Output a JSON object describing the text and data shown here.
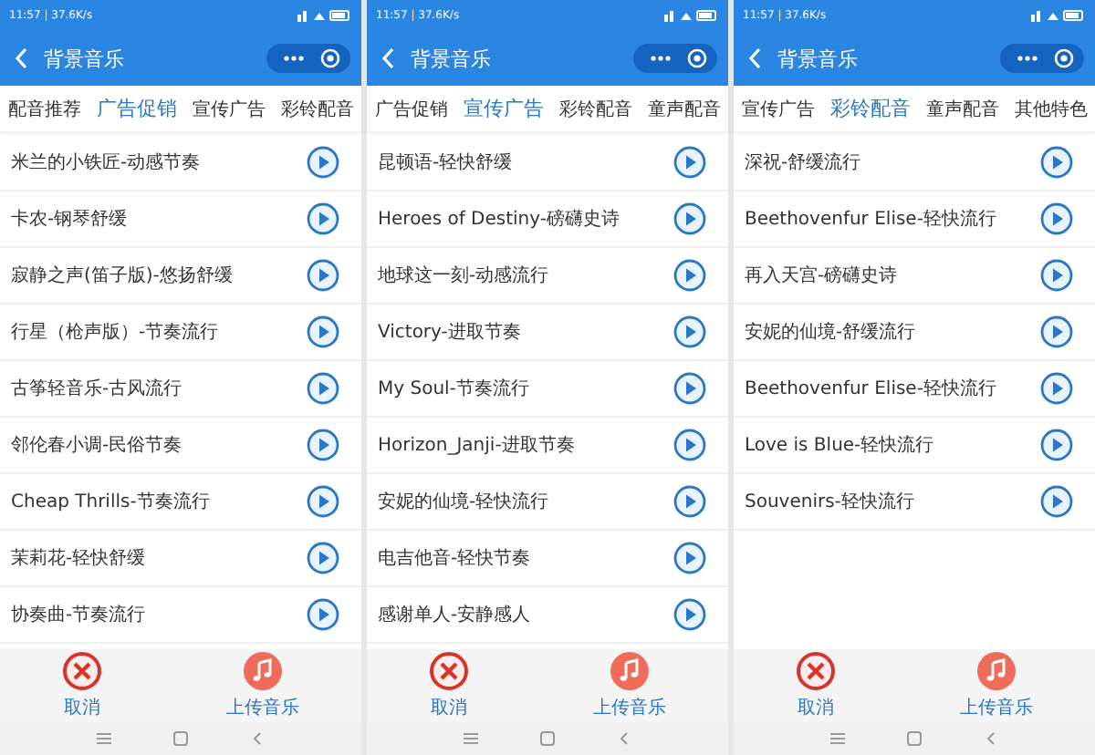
{
  "phones": [
    {
      "status": "11:57 | 37.6K/s",
      "title": "背景音乐",
      "tabs": [
        {
          "label": "配音推荐",
          "selected": false
        },
        {
          "label": "广告促销",
          "selected": true
        },
        {
          "label": "宣传广告",
          "selected": false
        },
        {
          "label": "彩铃配音",
          "selected": false
        }
      ],
      "songs": [
        "米兰的小铁匠-动感节奏",
        "卡农-钢琴舒缓",
        "寂静之声(笛子版)-悠扬舒缓",
        "行星（枪声版）-节奏流行",
        "古筝轻音乐-古风流行",
        "邻伦春小调-民俗节奏",
        "Cheap Thrills-节奏流行",
        "茉莉花-轻快舒缓",
        "协奏曲-节奏流行"
      ],
      "buttons": [
        {
          "kind": "cancel",
          "label": "取消"
        },
        {
          "kind": "upload",
          "label": "上传音乐"
        }
      ]
    },
    {
      "status": "11:57 | 37.6K/s",
      "title": "背景音乐",
      "tabs": [
        {
          "label": "广告促销",
          "selected": false
        },
        {
          "label": "宣传广告",
          "selected": true
        },
        {
          "label": "彩铃配音",
          "selected": false
        },
        {
          "label": "童声配音",
          "selected": false
        }
      ],
      "songs": [
        "昆顿语-轻快舒缓",
        "Heroes of Destiny-磅礴史诗",
        "地球这一刻-动感流行",
        "Victory-进取节奏",
        "My Soul-节奏流行",
        "Horizon_Janji-进取节奏",
        "安妮的仙境-轻快流行",
        "电吉他音-轻快节奏",
        "感谢单人-安静感人"
      ],
      "buttons": [
        {
          "kind": "cancel",
          "label": "取消"
        },
        {
          "kind": "upload",
          "label": "上传音乐"
        }
      ]
    },
    {
      "status": "11:57 | 37.6K/s",
      "title": "背景音乐",
      "tabs": [
        {
          "label": "宣传广告",
          "selected": false
        },
        {
          "label": "彩铃配音",
          "selected": true
        },
        {
          "label": "童声配音",
          "selected": false
        },
        {
          "label": "其他特色",
          "selected": false
        }
      ],
      "songs": [
        "深祝-舒缓流行",
        "Beethovenfur Elise-轻快流行",
        "再入天宫-磅礴史诗",
        "安妮的仙境-舒缓流行",
        "Beethovenfur Elise-轻快流行",
        "Love is Blue-轻快流行",
        "Souvenirs-轻快流行"
      ],
      "buttons": [
        {
          "kind": "cancel",
          "label": "取消"
        },
        {
          "kind": "upload",
          "label": "上传音乐"
        }
      ]
    }
  ]
}
